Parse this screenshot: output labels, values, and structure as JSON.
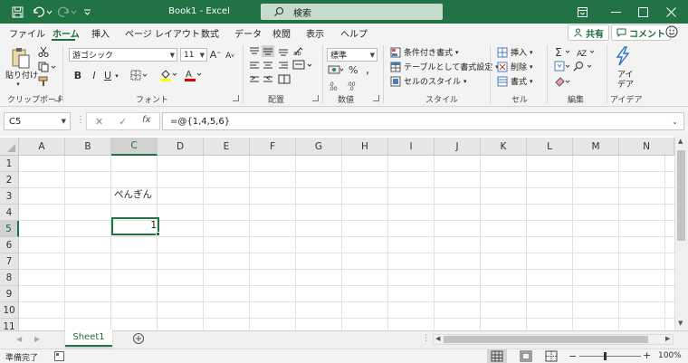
{
  "titlebar": {
    "title": "Book1  -  Excel",
    "search_placeholder": "検索"
  },
  "menu": {
    "tabs": [
      "ファイル",
      "ホーム",
      "挿入",
      "ページ レイアウト",
      "数式",
      "データ",
      "校閲",
      "表示",
      "ヘルプ"
    ],
    "active_tab": "ホーム",
    "share_label": "共有",
    "comment_label": "コメント"
  },
  "ribbon": {
    "clipboard": {
      "paste_label": "貼り付け",
      "group_label": "クリップボード"
    },
    "font": {
      "font_name": "游ゴシック",
      "font_size": "11",
      "bold": "B",
      "italic": "I",
      "underline": "U",
      "group_label": "フォント"
    },
    "alignment": {
      "group_label": "配置"
    },
    "number": {
      "format": "標準",
      "group_label": "数値"
    },
    "styles": {
      "conditional": "条件付き書式",
      "table": "テーブルとして書式設定",
      "cell_styles": "セルのスタイル",
      "group_label": "スタイル"
    },
    "cells": {
      "insert": "挿入",
      "delete": "削除",
      "format": "書式",
      "group_label": "セル"
    },
    "editing": {
      "group_label": "編集"
    },
    "ideas": {
      "label_line1": "アイ",
      "label_line2": "デア",
      "group_label": "アイデア"
    }
  },
  "formula_bar": {
    "name_box": "C5",
    "fx_label": "fx",
    "formula": "=@{1,4,5,6}"
  },
  "grid": {
    "columns": [
      "A",
      "B",
      "C",
      "D",
      "E",
      "F",
      "G",
      "H",
      "I",
      "J",
      "K",
      "L",
      "M",
      "N"
    ],
    "rows": [
      "1",
      "2",
      "3",
      "4",
      "5",
      "6",
      "7",
      "8",
      "9",
      "10",
      "11"
    ],
    "selected_column": "C",
    "selected_row": "5",
    "cell_C3": "ぺんぎん",
    "cell_C5": "1"
  },
  "sheets": {
    "tab": "Sheet1"
  },
  "status": {
    "ready": "準備完了",
    "zoom": "100%"
  },
  "colors": {
    "excel_green": "#217346",
    "accent_text": "#1e6b3c"
  }
}
